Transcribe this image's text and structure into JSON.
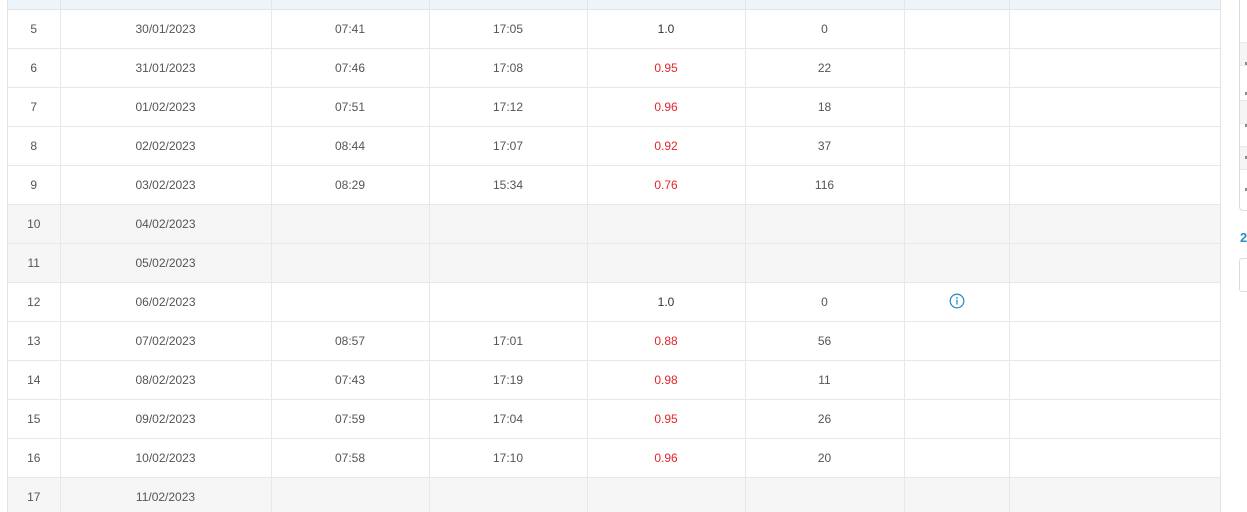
{
  "table": {
    "rows": [
      {
        "idx": "5",
        "date": "30/01/2023",
        "in": "07:41",
        "out": "17:05",
        "ratio": "1.0",
        "minutes": "0",
        "weekend": false,
        "ratio_color": "dark",
        "note_icon": ""
      },
      {
        "idx": "6",
        "date": "31/01/2023",
        "in": "07:46",
        "out": "17:08",
        "ratio": "0.95",
        "minutes": "22",
        "weekend": false,
        "ratio_color": "red",
        "note_icon": ""
      },
      {
        "idx": "7",
        "date": "01/02/2023",
        "in": "07:51",
        "out": "17:12",
        "ratio": "0.96",
        "minutes": "18",
        "weekend": false,
        "ratio_color": "red",
        "note_icon": ""
      },
      {
        "idx": "8",
        "date": "02/02/2023",
        "in": "08:44",
        "out": "17:07",
        "ratio": "0.92",
        "minutes": "37",
        "weekend": false,
        "ratio_color": "red",
        "note_icon": ""
      },
      {
        "idx": "9",
        "date": "03/02/2023",
        "in": "08:29",
        "out": "15:34",
        "ratio": "0.76",
        "minutes": "116",
        "weekend": false,
        "ratio_color": "red",
        "note_icon": ""
      },
      {
        "idx": "10",
        "date": "04/02/2023",
        "in": "",
        "out": "",
        "ratio": "",
        "minutes": "",
        "weekend": true,
        "ratio_color": "dark",
        "note_icon": ""
      },
      {
        "idx": "11",
        "date": "05/02/2023",
        "in": "",
        "out": "",
        "ratio": "",
        "minutes": "",
        "weekend": true,
        "ratio_color": "dark",
        "note_icon": ""
      },
      {
        "idx": "12",
        "date": "06/02/2023",
        "in": "",
        "out": "",
        "ratio": "1.0",
        "minutes": "0",
        "weekend": false,
        "ratio_color": "dark",
        "note_icon": "info-circle-icon"
      },
      {
        "idx": "13",
        "date": "07/02/2023",
        "in": "08:57",
        "out": "17:01",
        "ratio": "0.88",
        "minutes": "56",
        "weekend": false,
        "ratio_color": "red",
        "note_icon": ""
      },
      {
        "idx": "14",
        "date": "08/02/2023",
        "in": "07:43",
        "out": "17:19",
        "ratio": "0.98",
        "minutes": "11",
        "weekend": false,
        "ratio_color": "red",
        "note_icon": ""
      },
      {
        "idx": "15",
        "date": "09/02/2023",
        "in": "07:59",
        "out": "17:04",
        "ratio": "0.95",
        "minutes": "26",
        "weekend": false,
        "ratio_color": "red",
        "note_icon": ""
      },
      {
        "idx": "16",
        "date": "10/02/2023",
        "in": "07:58",
        "out": "17:10",
        "ratio": "0.96",
        "minutes": "20",
        "weekend": false,
        "ratio_color": "red",
        "note_icon": ""
      },
      {
        "idx": "17",
        "date": "11/02/2023",
        "in": "",
        "out": "",
        "ratio": "",
        "minutes": "",
        "weekend": true,
        "ratio_color": "dark",
        "note_icon": ""
      }
    ]
  },
  "side_panel": {
    "digit": "2"
  },
  "colors": {
    "ratio_red": "#e3262b",
    "accent_blue": "#2f8fc9",
    "weekend_bg": "#f6f6f6"
  }
}
